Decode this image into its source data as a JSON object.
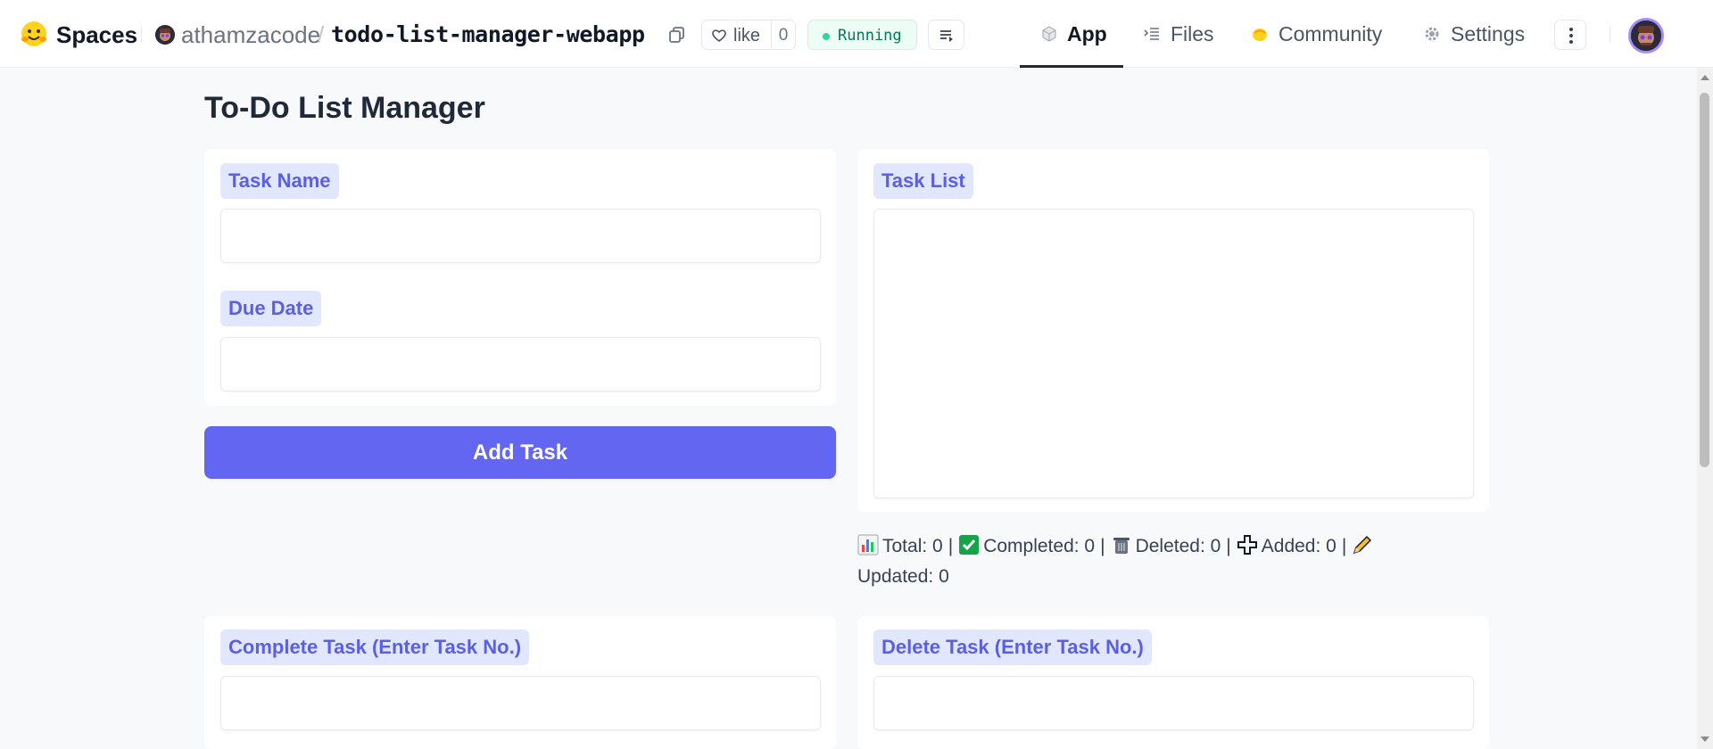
{
  "header": {
    "brand": "Spaces",
    "owner": "athamzacode",
    "slash": "/",
    "repo": "todo-list-manager-webapp",
    "like_label": "like",
    "like_count": "0",
    "status": "Running",
    "status_color": "#047857",
    "tabs": [
      {
        "label": "App",
        "icon": "cube-icon",
        "active": true
      },
      {
        "label": "Files",
        "icon": "files-icon",
        "active": false
      },
      {
        "label": "Community",
        "icon": "community-icon",
        "active": false
      },
      {
        "label": "Settings",
        "icon": "gear-icon",
        "active": false
      }
    ]
  },
  "main": {
    "title": "To-Do List Manager",
    "task_name_label": "Task Name",
    "task_name_value": "",
    "due_date_label": "Due Date",
    "due_date_value": "",
    "add_button": "Add Task",
    "task_list_label": "Task List",
    "task_list_value": "",
    "stats": {
      "total": "Total: 0",
      "completed": "Completed: 0",
      "deleted": "Deleted: 0",
      "added": "Added: 0",
      "updated": "Updated: 0"
    },
    "complete_label": "Complete Task (Enter Task No.)",
    "complete_value": "",
    "delete_label": "Delete Task (Enter Task No.)",
    "delete_value": ""
  },
  "colors": {
    "accent": "#6366f1",
    "label_bg": "#e0e7ff",
    "label_text": "#5b5fe0"
  }
}
